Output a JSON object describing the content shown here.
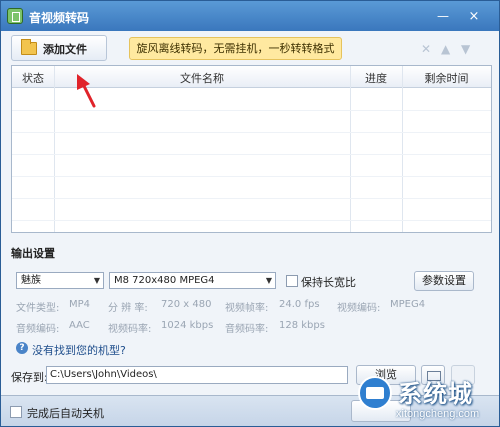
{
  "window": {
    "title": "音视频转码",
    "minimize_glyph": "—",
    "close_glyph": "×"
  },
  "toolbar": {
    "add_label": "添加文件",
    "add_icon": "folder-icon",
    "promo_text": "旋风离线转码，无需挂机，一秒转转格式",
    "icons": [
      "delete-icon",
      "move-up-icon",
      "move-down-icon"
    ]
  },
  "grid": {
    "columns": [
      "状态",
      "文件名称",
      "进度",
      "剩余时间"
    ],
    "rows": []
  },
  "output": {
    "section_title": "输出设置",
    "device": "魅族",
    "profile": "M8 720x480 MPEG4",
    "keep_ratio_label": "保持长宽比",
    "keep_ratio_checked": false,
    "param_button": "参数设置",
    "info": {
      "format_label": "文件类型:",
      "format_value": "MP4",
      "resolution_label": "分 辨 率:",
      "resolution_value": "720 x 480",
      "framerate_label": "视频帧率:",
      "framerate_value": "24.0 fps",
      "vcodec_label": "视频编码:",
      "vcodec_value": "MPEG4",
      "acodec_label": "音频编码:",
      "acodec_value": "AAC",
      "vbitrate_label": "视频码率:",
      "vbitrate_value": "1024 kbps",
      "abitrate_label": "音频码率:",
      "abitrate_value": "128 kbps"
    },
    "help_glyph": "?",
    "help_text": "没有找到您的机型?"
  },
  "save": {
    "label": "保存到:",
    "path": "C:\\Users\\John\\Videos\\",
    "browse_button": "浏览"
  },
  "bottom": {
    "shutdown_label": "完成后自动关机",
    "shutdown_checked": false
  },
  "watermark": {
    "title": "系统城",
    "url": "xitongcheng.com"
  },
  "colors": {
    "titlebar": "#3a77bd",
    "promo_bg": "#ffe9a0",
    "annotation_arrow": "#e0232a"
  }
}
